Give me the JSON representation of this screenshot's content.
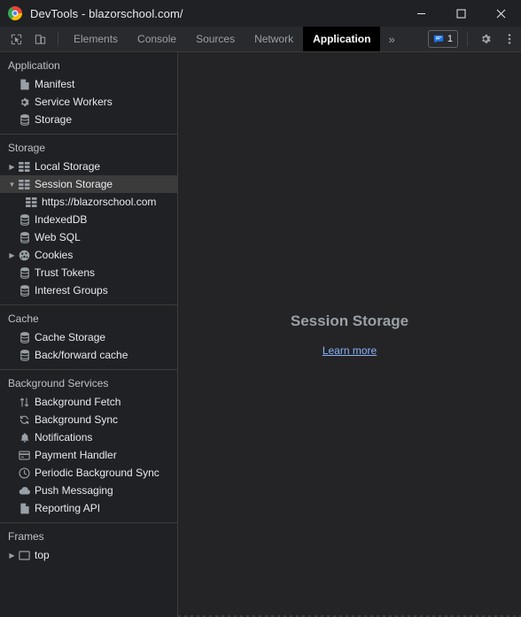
{
  "window": {
    "title": "DevTools - blazorschool.com/",
    "logo_icon": "chrome-logo-icon",
    "controls": {
      "minimize": "minimize-icon",
      "maximize": "maximize-icon",
      "close": "close-icon"
    }
  },
  "toolbar": {
    "inspect_icon": "inspect-element-icon",
    "device_icon": "device-toolbar-icon",
    "tabs": [
      {
        "label": "Elements",
        "active": false
      },
      {
        "label": "Console",
        "active": false
      },
      {
        "label": "Sources",
        "active": false
      },
      {
        "label": "Network",
        "active": false
      },
      {
        "label": "Application",
        "active": true
      }
    ],
    "more_tabs": "»",
    "message_icon": "message-bubble-icon",
    "message_count": "1",
    "settings_icon": "gear-icon",
    "more_icon": "kebab-menu-icon"
  },
  "sidebar": {
    "sections": [
      {
        "title": "Application",
        "items": [
          {
            "label": "Manifest",
            "icon": "document-icon",
            "arrow": "none",
            "indent": false,
            "selected": false
          },
          {
            "label": "Service Workers",
            "icon": "gear-icon",
            "arrow": "none",
            "indent": false,
            "selected": false
          },
          {
            "label": "Storage",
            "icon": "database-icon",
            "arrow": "none",
            "indent": false,
            "selected": false
          }
        ]
      },
      {
        "title": "Storage",
        "items": [
          {
            "label": "Local Storage",
            "icon": "table-grid-icon",
            "arrow": "collapsed",
            "indent": false,
            "selected": false
          },
          {
            "label": "Session Storage",
            "icon": "table-grid-icon",
            "arrow": "expanded",
            "indent": false,
            "selected": true
          },
          {
            "label": "https://blazorschool.com",
            "icon": "table-grid-icon",
            "arrow": "none",
            "indent": true,
            "selected": false
          },
          {
            "label": "IndexedDB",
            "icon": "database-icon",
            "arrow": "none",
            "indent": false,
            "selected": false
          },
          {
            "label": "Web SQL",
            "icon": "database-icon",
            "arrow": "none",
            "indent": false,
            "selected": false
          },
          {
            "label": "Cookies",
            "icon": "cookie-icon",
            "arrow": "collapsed",
            "indent": false,
            "selected": false
          },
          {
            "label": "Trust Tokens",
            "icon": "database-icon",
            "arrow": "none",
            "indent": false,
            "selected": false
          },
          {
            "label": "Interest Groups",
            "icon": "database-icon",
            "arrow": "none",
            "indent": false,
            "selected": false
          }
        ]
      },
      {
        "title": "Cache",
        "items": [
          {
            "label": "Cache Storage",
            "icon": "database-icon",
            "arrow": "none",
            "indent": false,
            "selected": false
          },
          {
            "label": "Back/forward cache",
            "icon": "database-icon",
            "arrow": "none",
            "indent": false,
            "selected": false
          }
        ]
      },
      {
        "title": "Background Services",
        "items": [
          {
            "label": "Background Fetch",
            "icon": "arrows-up-down-icon",
            "arrow": "none",
            "indent": false,
            "selected": false
          },
          {
            "label": "Background Sync",
            "icon": "sync-icon",
            "arrow": "none",
            "indent": false,
            "selected": false
          },
          {
            "label": "Notifications",
            "icon": "bell-icon",
            "arrow": "none",
            "indent": false,
            "selected": false
          },
          {
            "label": "Payment Handler",
            "icon": "credit-card-icon",
            "arrow": "none",
            "indent": false,
            "selected": false
          },
          {
            "label": "Periodic Background Sync",
            "icon": "clock-icon",
            "arrow": "none",
            "indent": false,
            "selected": false
          },
          {
            "label": "Push Messaging",
            "icon": "cloud-icon",
            "arrow": "none",
            "indent": false,
            "selected": false
          },
          {
            "label": "Reporting API",
            "icon": "document-icon",
            "arrow": "none",
            "indent": false,
            "selected": false
          }
        ]
      },
      {
        "title": "Frames",
        "items": [
          {
            "label": "top",
            "icon": "frame-icon",
            "arrow": "collapsed",
            "indent": false,
            "selected": false
          }
        ]
      }
    ]
  },
  "main": {
    "empty_title": "Session Storage",
    "learn_more": "Learn more"
  },
  "colors": {
    "background": "#202124",
    "panel": "#242427",
    "toolbar": "#292a2d",
    "active_tab": "#000000",
    "selection": "#3b3b3b",
    "text": "#e8eaed",
    "muted_text": "#9aa0a6",
    "link": "#8ab4f8",
    "accent": "#1a73e8",
    "divider": "#3c3c3c"
  }
}
